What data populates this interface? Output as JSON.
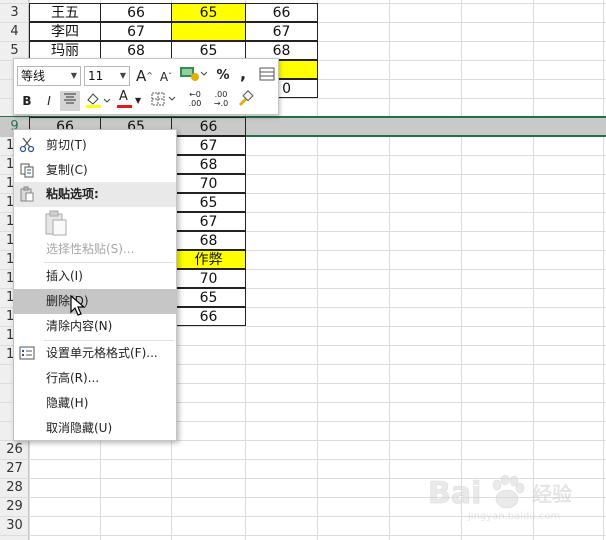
{
  "rows": {
    "visible_numbers": [
      "3",
      "4",
      "5",
      "9",
      "26",
      "27",
      "28",
      "29",
      "30"
    ],
    "partial_numbers": [
      "1",
      "1",
      "1",
      "1",
      "1",
      "1",
      "1",
      "1",
      "1",
      "1",
      "1",
      "1"
    ]
  },
  "top_table": [
    {
      "c1": "王五",
      "c2": "66",
      "c3": "65",
      "c4": "66",
      "c3_highlight": true
    },
    {
      "c1": "李四",
      "c2": "67",
      "c3": "",
      "c4": "67",
      "c3_highlight": true
    },
    {
      "c1": "玛丽",
      "c2": "68",
      "c3": "65",
      "c4": "68",
      "c3_highlight": false
    }
  ],
  "right_partial": {
    "cell_g": "0"
  },
  "selected_row": {
    "c1": "66",
    "c2": "65",
    "c3": "66"
  },
  "lower_column": [
    "67",
    "68",
    "70",
    "65",
    "67",
    "68",
    "作弊",
    "70",
    "65",
    "66"
  ],
  "lower_highlight_index": 6,
  "mini_toolbar": {
    "font_name": "等线",
    "font_size": "11",
    "increase_font": "A",
    "decrease_font": "A",
    "percent": "%",
    "comma": ",",
    "bold": "B",
    "italic": "I",
    "font_color_letter": "A",
    "inc_decimal_top": "←0",
    "inc_decimal_bottom": ".00",
    "dec_decimal_top": ".00",
    "dec_decimal_bottom": "→.0",
    "fill_color": "#ffff00",
    "font_color": "#e31a1c"
  },
  "context_menu": {
    "cut": "剪切(T)",
    "copy": "复制(C)",
    "paste_options": "粘贴选项:",
    "paste_special": "选择性粘贴(S)...",
    "insert": "插入(I)",
    "delete": "删除(D)",
    "clear": "清除内容(N)",
    "format_cells": "设置单元格格式(F)...",
    "row_height": "行高(R)...",
    "hide": "隐藏(H)",
    "unhide": "取消隐藏(U)"
  },
  "watermark": {
    "text": "Bai du 经验",
    "sub": "jingyan.baidu.com"
  },
  "colors": {
    "highlight": "#ffff00",
    "selection_band": "#c9c9c9",
    "accent": "#217346"
  }
}
